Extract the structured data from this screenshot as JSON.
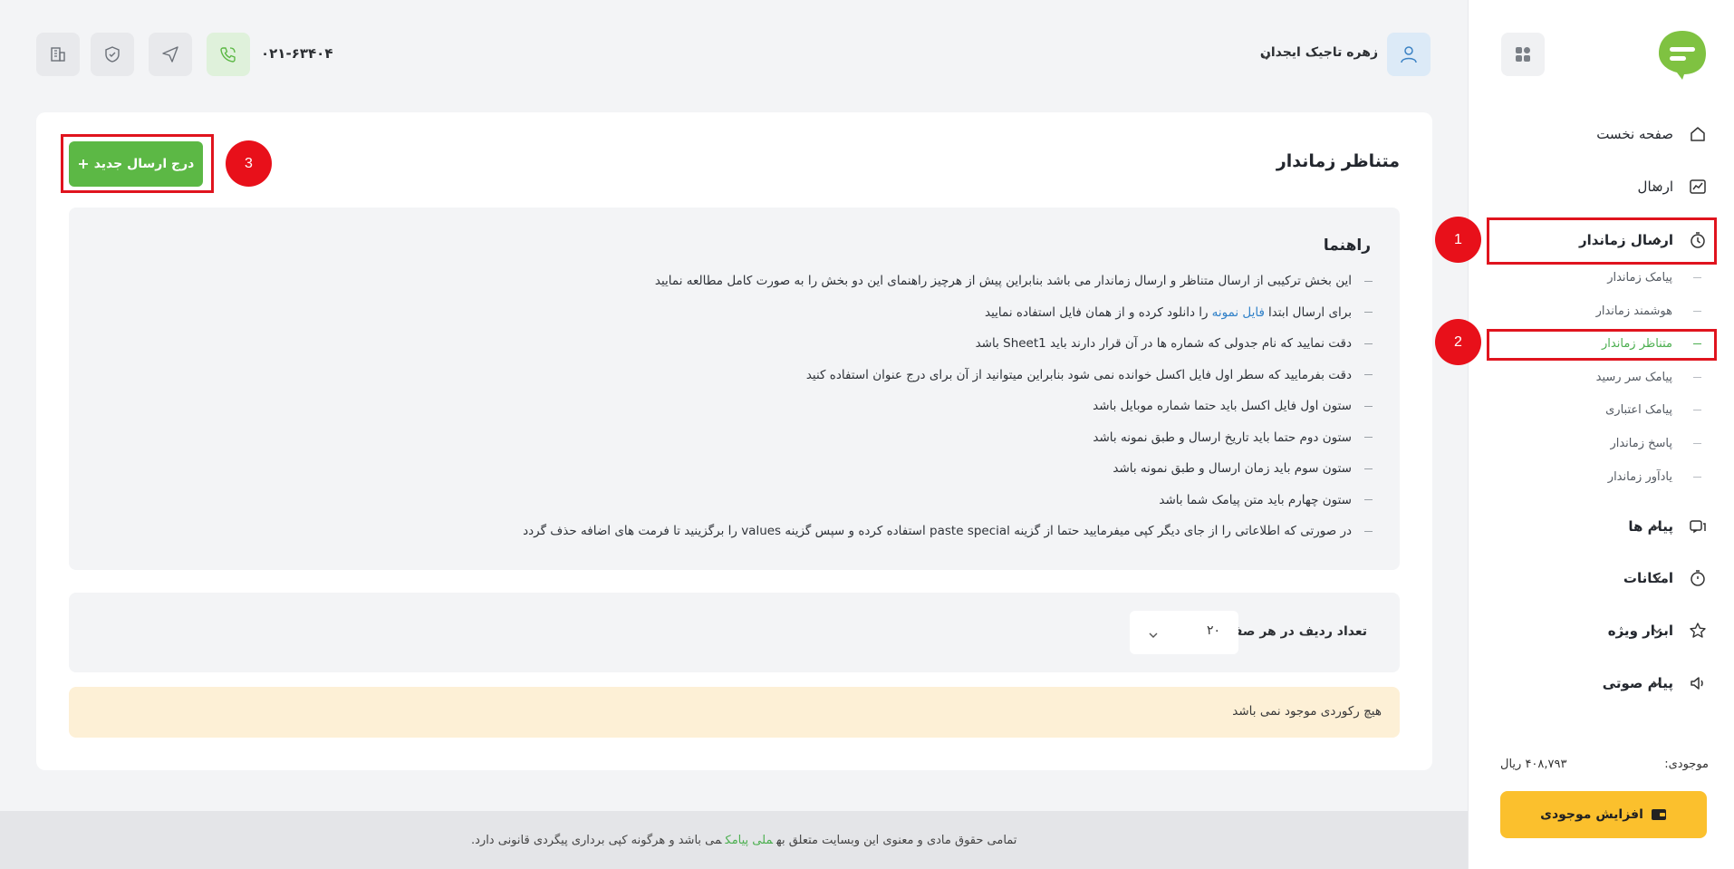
{
  "sidebar": {
    "items": [
      {
        "label": "صفحه نخست",
        "icon": "home-icon"
      },
      {
        "label": "ارسال",
        "icon": "send-chart-icon"
      },
      {
        "label": "ارسال زماندار",
        "icon": "timer-icon"
      },
      {
        "label": "پیام ها",
        "icon": "messages-icon"
      },
      {
        "label": "امکانات",
        "icon": "stopwatch-icon"
      },
      {
        "label": "ابزار ویژه",
        "icon": "star-icon"
      },
      {
        "label": "پیام صوتی",
        "icon": "speaker-icon"
      }
    ],
    "sub_items": [
      {
        "label": "پیامک زماندار"
      },
      {
        "label": "هوشمند زماندار"
      },
      {
        "label": "متناظر زماندار"
      },
      {
        "label": "پیامک سر رسید"
      },
      {
        "label": "پیامک اعتباری"
      },
      {
        "label": "پاسخ زماندار"
      },
      {
        "label": "یادآور زماندار"
      }
    ],
    "balance_label": "موجودی:",
    "balance_value": "۴۰۸,۷۹۳ ریال",
    "topup_label": "افزایش موجودی"
  },
  "header": {
    "phone": "۰۲۱-۶۳۴۰۴",
    "user_name": "زهره تاجیک ایجدان"
  },
  "main": {
    "title": "متناظر زماندار",
    "new_button": "درج ارسال جدید",
    "guide_title": "راهنما",
    "guide": [
      {
        "text": "این بخش ترکیبی از ارسال متناظر و ارسال زماندار می باشد بنابراین پیش از هرچیز راهنمای این دو بخش را به صورت کامل مطالعه نمایید"
      },
      {
        "pre": "برای ارسال ابتدا",
        "link": "فایل نمونه",
        "post": "را دانلود کرده و از همان فایل استفاده نمایید"
      },
      {
        "text": "دقت نمایید که نام جدولی که شماره ها در آن قرار دارند باید Sheet1 باشد"
      },
      {
        "text": "دقت بفرمایید که سطر اول فایل اکسل خوانده نمی شود بنابراین میتوانید از آن برای درج عنوان استفاده کنید"
      },
      {
        "text": "ستون اول فایل اکسل باید حتما شماره موبایل باشد"
      },
      {
        "text": "ستون دوم حتما باید تاریخ ارسال و طبق نمونه باشد"
      },
      {
        "text": "ستون سوم باید زمان ارسال و طبق نمونه باشد"
      },
      {
        "text": "ستون چهارم باید متن پیامک شما باشد"
      },
      {
        "text": "در صورتی که اطلاعاتی را از جای دیگر کپی میفرمایید حتما از گزینه paste special استفاده کرده و سپس گزینه values را برگزینید تا فرمت های اضافه حذف گردد"
      }
    ],
    "rows_label": "تعداد ردیف در هر صفحه :",
    "rows_value": "۲۰",
    "empty_message": "هیچ رکوردی موجود نمی باشد"
  },
  "footer": {
    "pre": "تمامی حقوق مادی و معنوی این وبسایت متعلق به",
    "link": "ملی پیامک",
    "post": "می باشد و هرگونه کپی برداری پیگردی قانونی دارد."
  },
  "annotations": [
    "1",
    "2",
    "3"
  ],
  "colors": {
    "brand_green": "#5cb845",
    "warning_yellow": "#fbc02d",
    "annotation_red": "#e0141e",
    "link_blue": "#2f80c8"
  }
}
